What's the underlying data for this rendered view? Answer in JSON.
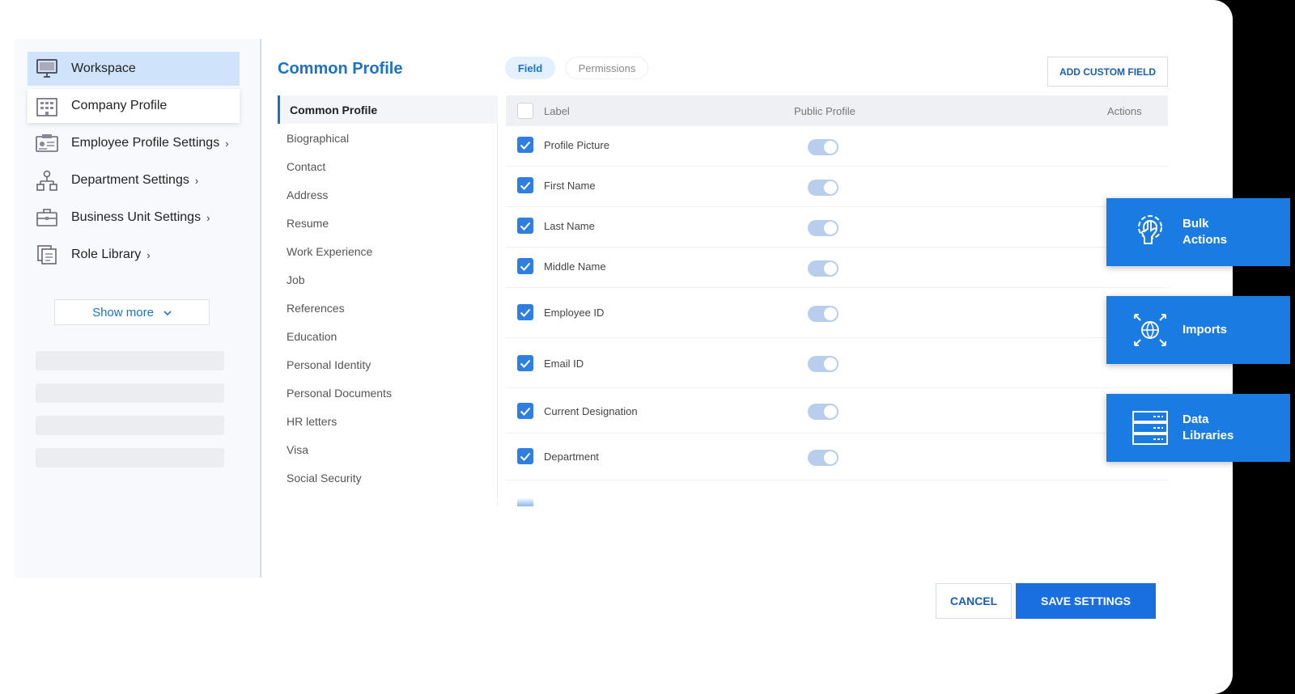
{
  "sidebar": {
    "items": [
      {
        "label": "Workspace",
        "icon": "monitor-icon"
      },
      {
        "label": "Company Profile",
        "icon": "building-icon"
      },
      {
        "label": "Employee Profile Settings",
        "icon": "id-card-icon"
      },
      {
        "label": "Department Settings",
        "icon": "org-chart-icon"
      },
      {
        "label": "Business Unit Settings",
        "icon": "briefcase-icon"
      },
      {
        "label": "Role Library",
        "icon": "stack-icon"
      }
    ],
    "show_more": "Show more"
  },
  "header": {
    "title": "Common Profile",
    "tabs": [
      {
        "label": "Field"
      },
      {
        "label": "Permissions"
      }
    ],
    "add_custom_field": "ADD CUSTOM FIELD"
  },
  "categories": [
    "Common Profile",
    "Biographical",
    "Contact",
    "Address",
    "Resume",
    "Work Experience",
    "Job",
    "References",
    "Education",
    "Personal Identity",
    "Personal Documents",
    "HR letters",
    "Visa",
    "Social Security"
  ],
  "table": {
    "columns": {
      "label": "Label",
      "public_profile": "Public Profile",
      "actions": "Actions"
    },
    "rows": [
      {
        "label": "Profile Picture",
        "checked": true,
        "public": true
      },
      {
        "label": "First Name",
        "checked": true,
        "public": true
      },
      {
        "label": "Last Name",
        "checked": true,
        "public": true
      },
      {
        "label": "Middle Name",
        "checked": true,
        "public": true
      },
      {
        "label": "Employee ID",
        "checked": true,
        "public": true
      },
      {
        "label": "Email ID",
        "checked": true,
        "public": true
      },
      {
        "label": "Current Designation",
        "checked": true,
        "public": true
      },
      {
        "label": "Department",
        "checked": true,
        "public": true
      }
    ]
  },
  "tiles": [
    {
      "label": "Bulk Actions",
      "icon": "gear-hand-icon"
    },
    {
      "label": "Imports",
      "icon": "globe-arrows-icon"
    },
    {
      "label": "Data Libraries",
      "icon": "server-icon"
    }
  ],
  "footer": {
    "cancel": "CANCEL",
    "save": "SAVE SETTINGS"
  },
  "colors": {
    "accent": "#1a73c8",
    "tile": "#1a7ce3",
    "active_nav": "#cfe3fb"
  }
}
